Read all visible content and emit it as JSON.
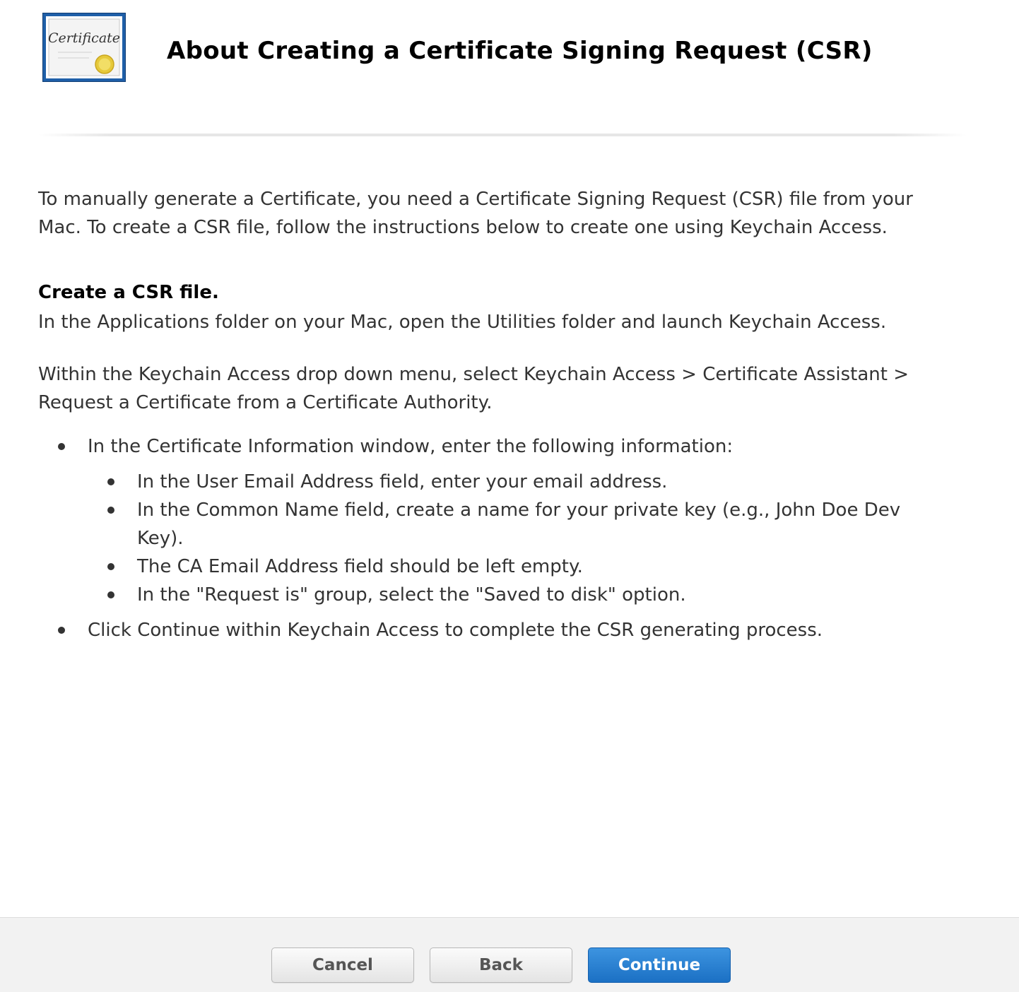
{
  "header": {
    "title": "About Creating a Certificate Signing Request (CSR)",
    "icon": "certificate-icon",
    "icon_text": "Certificate"
  },
  "content": {
    "intro": "To manually generate a Certificate, you need a Certificate Signing Request (CSR) file from your Mac. To create a CSR file, follow the instructions below to create one using Keychain Access.",
    "section_heading": "Create a CSR file.",
    "para1": "In the Applications folder on your Mac, open the Utilities folder and launch Keychain Access.",
    "para2": "Within the Keychain Access drop down menu, select Keychain Access > Certificate Assistant > Request a Certificate from a Certificate Authority.",
    "bullets": [
      {
        "text": "In the Certificate Information window, enter the following information:",
        "sub": [
          "In the User Email Address field, enter your email address.",
          "In the Common Name field, create a name for your private key (e.g., John Doe Dev Key).",
          "The CA Email Address field should be left empty.",
          "In the \"Request is\" group, select the \"Saved to disk\" option."
        ]
      },
      {
        "text": "Click Continue within Keychain Access to complete the CSR generating process."
      }
    ]
  },
  "footer": {
    "cancel_label": "Cancel",
    "back_label": "Back",
    "continue_label": "Continue"
  },
  "colors": {
    "primary_button": "#2a82d4",
    "footer_bg": "#f2f2f2",
    "icon_frame": "#1f5fa8"
  }
}
